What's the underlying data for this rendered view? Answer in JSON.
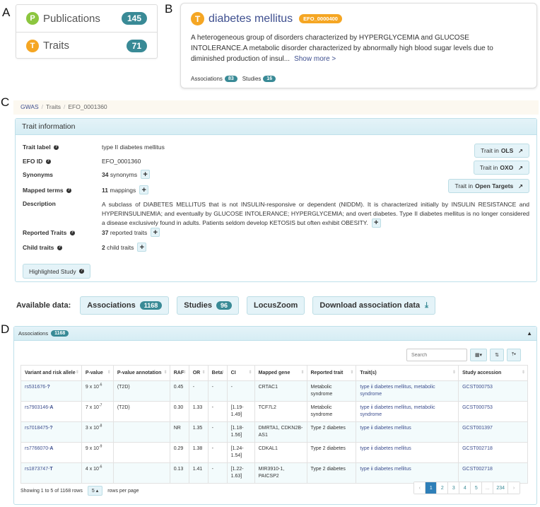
{
  "panel_letters": [
    "A",
    "B",
    "C",
    "D"
  ],
  "panel_a": {
    "items": [
      {
        "icon_letter": "P",
        "icon_color": "#8cc63f",
        "label": "Publications",
        "count": "145"
      },
      {
        "icon_letter": "T",
        "icon_color": "#f5a623",
        "label": "Traits",
        "count": "71"
      }
    ]
  },
  "panel_b": {
    "icon_letter": "T",
    "title": "diabetes mellitus",
    "efo_badge": "EFO_0000400",
    "description": "A heterogeneous group of disorders characterized by HYPERGLYCEMIA and GLUCOSE INTOLERANCE.A metabolic disorder characterized by abnormally high blood sugar levels due to diminished production of insul...",
    "show_more": "Show more >",
    "associations_label": "Associations",
    "associations_count": "83",
    "studies_label": "Studies",
    "studies_count": "16"
  },
  "breadcrumb": [
    "GWAS",
    "Traits",
    "EFO_0001360"
  ],
  "trait_info": {
    "heading": "Trait information",
    "trait_label_label": "Trait label",
    "trait_label_value": "type II diabetes mellitus",
    "efo_id_label": "EFO ID",
    "efo_id_value": "EFO_0001360",
    "synonyms_label": "Synonyms",
    "synonyms_count": "34",
    "synonyms_suffix": "synonyms",
    "mapped_terms_label": "Mapped terms",
    "mapped_terms_count": "11",
    "mapped_terms_suffix": "mappings",
    "description_label": "Description",
    "description_value": "A subclass of DIABETES MELLITUS that is not INSULIN-responsive or dependent (NIDDM). It is characterized initially by INSULIN RESISTANCE and HYPERINSULINEMIA; and eventually by GLUCOSE INTOLERANCE; HYPERGLYCEMIA; and overt diabetes. Type II diabetes mellitus is no longer considered a disease exclusively found in adults. Patients seldom develop KETOSIS but often exhibit OBESITY.",
    "reported_traits_label": "Reported Traits",
    "reported_traits_count": "37",
    "reported_traits_suffix": "reported traits",
    "child_traits_label": "Child traits",
    "child_traits_count": "2",
    "child_traits_suffix": "child traits",
    "highlighted_study_label": "Highlighted Study",
    "ext_buttons": [
      {
        "prefix": "Trait in",
        "target": "OLS"
      },
      {
        "prefix": "Trait in",
        "target": "OXO"
      },
      {
        "prefix": "Trait in",
        "target": "Open Targets"
      }
    ]
  },
  "available_data": {
    "label": "Available data:",
    "associations_label": "Associations",
    "associations_count": "1168",
    "studies_label": "Studies",
    "studies_count": "96",
    "locuszoom_label": "LocusZoom",
    "download_label": "Download association data"
  },
  "associations_panel": {
    "heading": "Associations",
    "count": "1168",
    "search_placeholder": "Search",
    "columns": [
      "Variant and risk allele",
      "P-value",
      "P-value annotation",
      "RAF",
      "OR",
      "Beta",
      "CI",
      "Mapped gene",
      "Reported trait",
      "Trait(s)",
      "Study accession"
    ],
    "rows": [
      {
        "variant": "rs531676-",
        "allele": "?",
        "p_mant": "9 x 10",
        "p_exp": "-6",
        "annotation": "(T2D)",
        "raf": "0.45",
        "or": "-",
        "beta": "-",
        "ci": "-",
        "gene": "CRTAC1",
        "reported": "Metabolic syndrome",
        "traits": "type ii diabetes mellitus, metabolic syndrome",
        "study": "GCST000753"
      },
      {
        "variant": "rs7903146-",
        "allele": "A",
        "p_mant": "7 x 10",
        "p_exp": "-7",
        "annotation": "(T2D)",
        "raf": "0.30",
        "or": "1.33",
        "beta": "-",
        "ci": "[1.19-1.49]",
        "gene": "TCF7L2",
        "reported": "Metabolic syndrome",
        "traits": "type ii diabetes mellitus, metabolic syndrome",
        "study": "GCST000753"
      },
      {
        "variant": "rs7018475-",
        "allele": "?",
        "p_mant": "3 x 10",
        "p_exp": "-8",
        "annotation": "",
        "raf": "NR",
        "or": "1.35",
        "beta": "-",
        "ci": "[1.18-1.56]",
        "gene": "DMRTA1, CDKN2B-AS1",
        "reported": "Type 2 diabetes",
        "traits": "type ii diabetes mellitus",
        "study": "GCST001397"
      },
      {
        "variant": "rs7766070-",
        "allele": "A",
        "p_mant": "9 x 10",
        "p_exp": "-9",
        "annotation": "",
        "raf": "0.29",
        "or": "1.38",
        "beta": "-",
        "ci": "[1.24-1.54]",
        "gene": "CDKAL1",
        "reported": "Type 2 diabetes",
        "traits": "type ii diabetes mellitus",
        "study": "GCST002718"
      },
      {
        "variant": "rs1873747-",
        "allele": "T",
        "p_mant": "4 x 10",
        "p_exp": "-6",
        "annotation": "",
        "raf": "0.13",
        "or": "1.41",
        "beta": "-",
        "ci": "[1.22-1.63]",
        "gene": "MIR3910-1, PAICSP2",
        "reported": "Type 2 diabetes",
        "traits": "type ii diabetes mellitus",
        "study": "GCST002718"
      }
    ],
    "footer_showing": "Showing 1 to 5 of 1168 rows",
    "page_size": "5",
    "rows_per_page": "rows per page",
    "pages": [
      "‹",
      "1",
      "2",
      "3",
      "4",
      "5",
      "...",
      "234",
      "›"
    ],
    "active_page": "1"
  },
  "icons": {
    "question": "?",
    "plus": "+",
    "external_link": "↗",
    "download": "⤓",
    "chevron_up": "▲",
    "columns": "▦▾",
    "sort": "⇅",
    "export": "⤒▾",
    "caret": "▴",
    "sort_arrows": "⇕"
  }
}
